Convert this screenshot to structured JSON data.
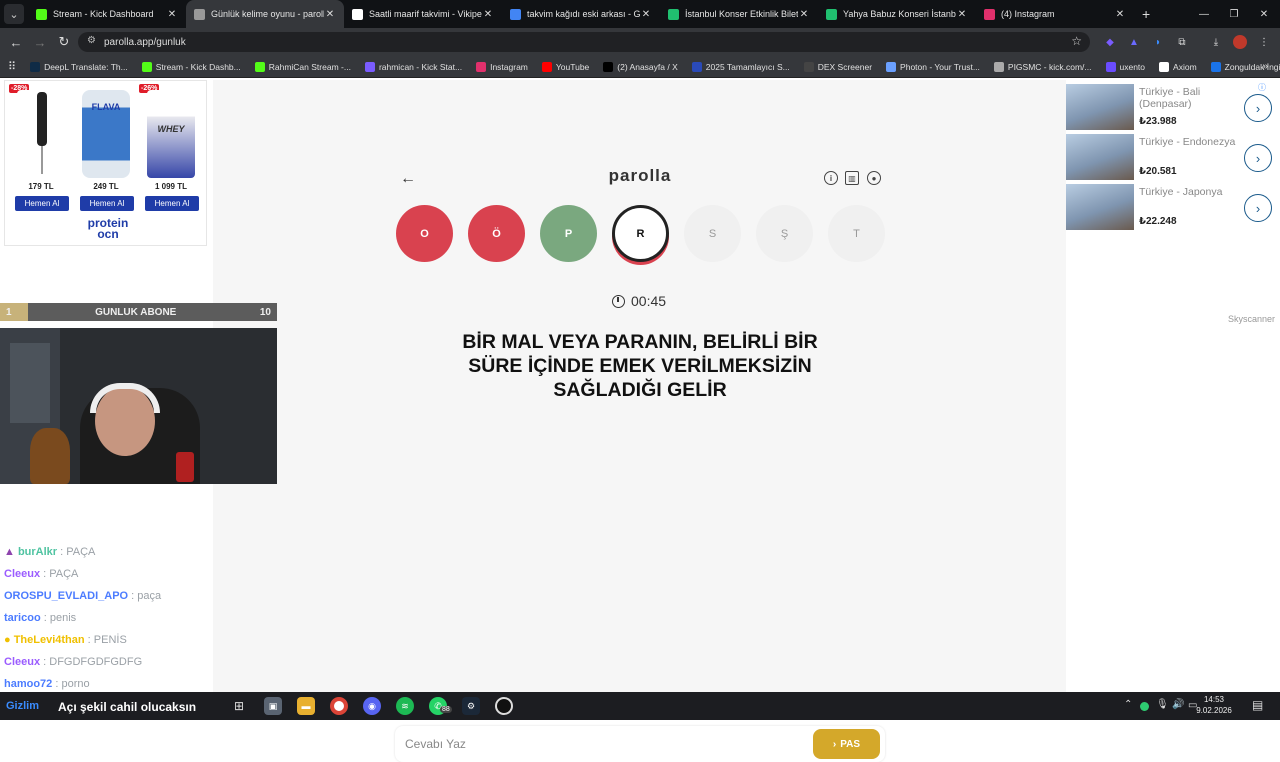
{
  "tabs": [
    {
      "title": "Stream - Kick Dashboard",
      "icon": "kick-icon",
      "color": "#53fc18",
      "active": false
    },
    {
      "title": "Günlük kelime oyunu - parolla",
      "icon": "parolla-icon",
      "color": "#999999",
      "active": true
    },
    {
      "title": "Saatli maarif takvimi - Vikipedi",
      "icon": "wikipedia-icon",
      "color": "#ffffff",
      "active": false
    },
    {
      "title": "takvim kağıdı eski arkası - Goo",
      "icon": "google-icon",
      "color": "#4285f4",
      "active": false
    },
    {
      "title": "İstanbul Konser Etkinlik Biletleri",
      "icon": "biletix-icon",
      "color": "#20c070",
      "active": false
    },
    {
      "title": "Yahya Babuz Konseri İstanbul b",
      "icon": "biletix-icon",
      "color": "#20c070",
      "active": false
    },
    {
      "title": "(4) Instagram",
      "icon": "instagram-icon",
      "color": "#e1306c",
      "active": false
    }
  ],
  "url": "parolla.app/gunluk",
  "bookmarks": [
    {
      "label": "DeepL Translate: Th...",
      "color": "#0f2b46"
    },
    {
      "label": "Stream - Kick Dashb...",
      "color": "#53fc18"
    },
    {
      "label": "RahmiCan Stream -...",
      "color": "#53fc18"
    },
    {
      "label": "rahmican - Kick Stat...",
      "color": "#7a5cff"
    },
    {
      "label": "Instagram",
      "color": "#e1306c"
    },
    {
      "label": "YouTube",
      "color": "#ff0000"
    },
    {
      "label": "(2) Anasayfa / X",
      "color": "#000000"
    },
    {
      "label": "2025 Tamamlayıcı S...",
      "color": "#2a4ab8"
    },
    {
      "label": "DEX Screener",
      "color": "#444444"
    },
    {
      "label": "Photon - Your Trust...",
      "color": "#6aa0ff"
    },
    {
      "label": "PIGSMC - kick.com/...",
      "color": "#aaaaaa"
    },
    {
      "label": "uxento",
      "color": "#6a4cff"
    },
    {
      "label": "Axiom",
      "color": "#ffffff"
    },
    {
      "label": "Zonguldak İngilizce...",
      "color": "#1a73e8"
    }
  ],
  "ad": {
    "products": [
      {
        "discount": "-28%",
        "price": "179 TL",
        "button": "Hemen Al"
      },
      {
        "discount": "",
        "price": "249 TL",
        "button": "Hemen Al",
        "label": "FLAVA"
      },
      {
        "discount": "-26%",
        "price": "1 099 TL",
        "button": "Hemen Al",
        "label": "WHEY"
      }
    ],
    "brand_line1": "protein",
    "brand_line2": "ocn"
  },
  "subgoal": {
    "left": "1",
    "label": "GUNLUK ABONE",
    "right": "10",
    "progress": 0.1
  },
  "chat": [
    {
      "user": "burAlkr",
      "message": "PAÇA",
      "color": "#4fc3a1",
      "badge": "purple"
    },
    {
      "user": "Cleeux",
      "message": "PAÇA",
      "color": "#9b5cff"
    },
    {
      "user": "OROSPU_EVLADI_APO",
      "message": "paça",
      "color": "#4c7cff"
    },
    {
      "user": "taricoo",
      "message": "penis",
      "color": "#4c7cff"
    },
    {
      "user": "TheLevi4than",
      "message": "PENİS",
      "color": "#f0c000",
      "badge": "yellow"
    },
    {
      "user": "Cleeux",
      "message": "DFGDFGDFGDFG",
      "color": "#9b5cff"
    },
    {
      "user": "hamoo72",
      "message": "porno",
      "color": "#4c7cff"
    }
  ],
  "game": {
    "logo": "parolla",
    "letters": [
      {
        "letter": "O",
        "state": "wrong",
        "color": "#d9424f"
      },
      {
        "letter": "Ö",
        "state": "wrong",
        "color": "#d9424f"
      },
      {
        "letter": "P",
        "state": "correct",
        "color": "#7aa87f"
      },
      {
        "letter": "R",
        "state": "current",
        "color": "#ffffff"
      },
      {
        "letter": "S",
        "state": "pending",
        "color": "#f0f0f0"
      },
      {
        "letter": "Ş",
        "state": "pending",
        "color": "#f0f0f0"
      },
      {
        "letter": "T",
        "state": "pending",
        "color": "#f0f0f0"
      }
    ],
    "timer": "00:45",
    "question": "BİR MAL VEYA PARANIN, BELİRLİ BİR SÜRE İÇİNDE EMEK VERİLMEKSİZİN SAĞLADIĞI GELİR",
    "answer_placeholder": "Cevabı Yaz",
    "pass_label": "PAS"
  },
  "flights": [
    {
      "destination": "Türkiye - Bali (Denpasar)",
      "price": "₺23.988"
    },
    {
      "destination": "Türkiye - Endonezya",
      "price": "₺20.581"
    },
    {
      "destination": "Türkiye - Japonya",
      "price": "₺22.248"
    }
  ],
  "flights_brand": "Skyscanner",
  "overlay_text": "Açı şekil cahil olucaksın",
  "overlay_name": "Gizlim",
  "taskbar": {
    "time": "14:53",
    "date": "9.02.2026",
    "badge": "88"
  }
}
